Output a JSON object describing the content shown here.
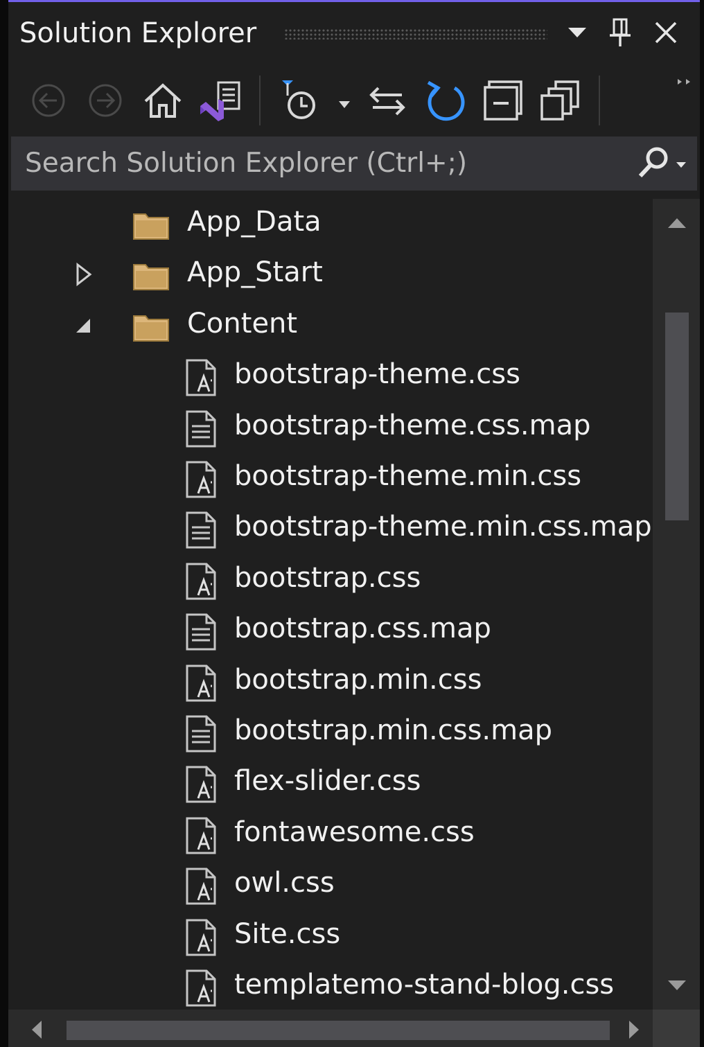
{
  "window": {
    "title": "Solution Explorer",
    "accent_color": "#7160e8",
    "buttons": [
      {
        "name": "window-position-dropdown",
        "icon": "caret-down-icon"
      },
      {
        "name": "auto-hide-pin",
        "icon": "pin-icon"
      },
      {
        "name": "close",
        "icon": "close-icon"
      }
    ]
  },
  "toolbar": {
    "items": [
      {
        "name": "back",
        "icon": "back-arrow-icon",
        "enabled": false
      },
      {
        "name": "forward",
        "icon": "forward-arrow-icon",
        "enabled": false
      },
      {
        "name": "home",
        "icon": "home-icon",
        "enabled": true
      },
      {
        "name": "switch-views",
        "icon": "switch-views-icon",
        "enabled": true
      },
      {
        "name": "pending-changes-filter",
        "icon": "clock-filter-icon",
        "enabled": true
      },
      {
        "name": "sync-with-active-document",
        "icon": "sync-icon",
        "enabled": true
      },
      {
        "name": "refresh",
        "icon": "refresh-icon",
        "enabled": true
      },
      {
        "name": "collapse-all",
        "icon": "collapse-all-icon",
        "enabled": true
      },
      {
        "name": "show-all-files",
        "icon": "show-all-files-icon",
        "enabled": true
      },
      {
        "name": "toolbar-overflow",
        "icon": "overflow-icon",
        "enabled": true
      }
    ]
  },
  "search": {
    "placeholder": "Search Solution Explorer (Ctrl+;)",
    "icon": "search-icon"
  },
  "tree": {
    "items": [
      {
        "label": "App_Data",
        "type": "folder",
        "level": 1,
        "expander": "none"
      },
      {
        "label": "App_Start",
        "type": "folder",
        "level": 1,
        "expander": "collapsed"
      },
      {
        "label": "Content",
        "type": "folder",
        "level": 1,
        "expander": "expanded"
      },
      {
        "label": "bootstrap-theme.css",
        "type": "css",
        "level": 2
      },
      {
        "label": "bootstrap-theme.css.map",
        "type": "text",
        "level": 2
      },
      {
        "label": "bootstrap-theme.min.css",
        "type": "css",
        "level": 2
      },
      {
        "label": "bootstrap-theme.min.css.map",
        "type": "text",
        "level": 2
      },
      {
        "label": "bootstrap.css",
        "type": "css",
        "level": 2
      },
      {
        "label": "bootstrap.css.map",
        "type": "text",
        "level": 2
      },
      {
        "label": "bootstrap.min.css",
        "type": "css",
        "level": 2
      },
      {
        "label": "bootstrap.min.css.map",
        "type": "text",
        "level": 2
      },
      {
        "label": "flex-slider.css",
        "type": "css",
        "level": 2
      },
      {
        "label": "fontawesome.css",
        "type": "css",
        "level": 2
      },
      {
        "label": "owl.css",
        "type": "css",
        "level": 2
      },
      {
        "label": "Site.css",
        "type": "css",
        "level": 2
      },
      {
        "label": "templatemo-stand-blog.css",
        "type": "css",
        "level": 2
      }
    ]
  },
  "colors": {
    "background": "#1f1f1f",
    "text": "#f1f1f1",
    "folder": "#dcb67a",
    "icon_gray": "#c5c5c5",
    "refresh_blue": "#3794ff",
    "vs_purple": "#8c5ad8"
  }
}
